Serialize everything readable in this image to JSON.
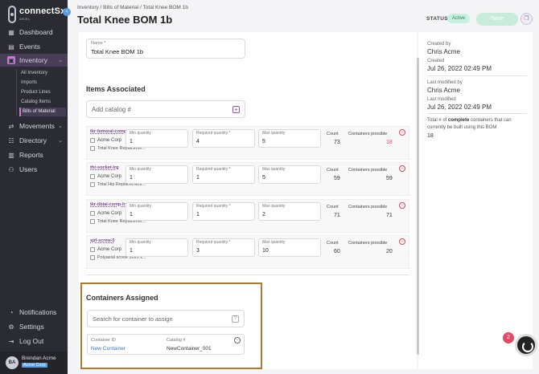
{
  "app": {
    "name": "connectSx",
    "sub": "ARIEL"
  },
  "sidebar": {
    "items": [
      {
        "label": "Dashboard",
        "icon": "grid-icon"
      },
      {
        "label": "Events",
        "icon": "calendar-icon"
      },
      {
        "label": "Inventory",
        "icon": "box-icon"
      },
      {
        "label": "Movements",
        "icon": "arrows-icon"
      },
      {
        "label": "Directory",
        "icon": "people-icon"
      },
      {
        "label": "Reports",
        "icon": "chart-icon"
      },
      {
        "label": "Users",
        "icon": "users-icon"
      }
    ],
    "subitems": [
      "All Inventory",
      "Imports",
      "Product Lines",
      "Catalog Items",
      "Bills of Material"
    ],
    "bottom": [
      {
        "label": "Notifications",
        "icon": "bell-icon"
      },
      {
        "label": "Settings",
        "icon": "gear-icon"
      },
      {
        "label": "Log Out",
        "icon": "logout-icon"
      }
    ],
    "user": {
      "initials": "BA",
      "name": "Brendan Acme",
      "corp": "Acme Corp"
    }
  },
  "header": {
    "breadcrumb": "Inventory / Bills of Material / Total Knee BOM 1b",
    "title": "Total Knee BOM 1b",
    "status_label": "STATUS",
    "status_value": "Active",
    "save_label": "Save"
  },
  "form": {
    "name_label": "Name *",
    "name_value": "Total Knee BOM 1b"
  },
  "items_section": {
    "title": "Items Associated",
    "add_placeholder": "Add catalog #",
    "labels": {
      "min": "Min quantity",
      "req": "Required quantity *",
      "max": "Max quantity",
      "count": "Count",
      "possible": "Containers possible"
    },
    "rows": [
      {
        "name": "tkr-femoral-comp-sml",
        "corp": "Acme Corp",
        "desc": "Total Knee Replaceme...",
        "min": "1",
        "req": "4",
        "max": "5",
        "count": "73",
        "possible": "18"
      },
      {
        "name": "thr-socket-lrg",
        "corp": "Acme Corp",
        "desc": "Total Hip Replacement...",
        "min": "1",
        "req": "1",
        "max": "5",
        "count": "59",
        "possible": "59"
      },
      {
        "name": "tkr-tibial-comp-lrg",
        "corp": "Acme Corp",
        "desc": "Total Knee Replaceme...",
        "min": "1",
        "req": "1",
        "max": "2",
        "count": "71",
        "possible": "71"
      },
      {
        "name": "spf-screw-5",
        "corp": "Acme Corp",
        "desc": "Polyaxial screw 5mm x...",
        "min": "1",
        "req": "3",
        "max": "10",
        "count": "60",
        "possible": "20"
      }
    ]
  },
  "containers_section": {
    "title": "Containers Assigned",
    "search_placeholder": "Search for container to assign",
    "id_label": "Container ID",
    "id_value": "New Container",
    "catalog_label": "Catalog #",
    "catalog_value": "NewContainer_001"
  },
  "meta": {
    "created_by_label": "Created by",
    "created_by": "Chris Acme",
    "created_label": "Created",
    "created": "Jul 26, 2022 02:49 PM",
    "modified_by_label": "Last modified by",
    "modified_by": "Chris Acme",
    "modified_label": "Last modified",
    "modified": "Jul 26, 2022 02:49 PM",
    "note_prefix": "Total # of ",
    "note_bold": "complete",
    "note_suffix": " containers that can currently be built using this BOM",
    "note_value": "18"
  },
  "float": {
    "badge": "2"
  },
  "colors": {
    "accent": "#9a4fab",
    "sidebar": "#2b2b33",
    "status_green": "#2e8a62",
    "highlight_border": "#b0782a",
    "link": "#3a7acc",
    "warning": "#d04a5a"
  }
}
